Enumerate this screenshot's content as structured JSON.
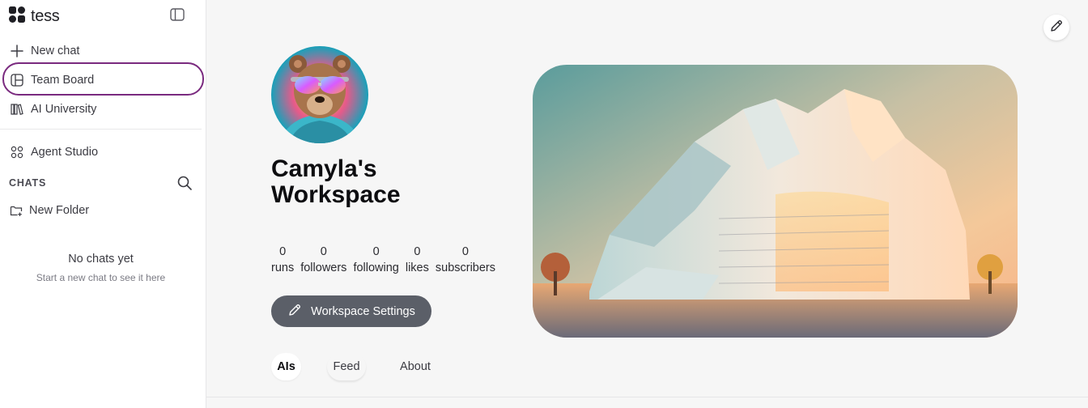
{
  "app": {
    "name": "tess"
  },
  "sidebar": {
    "new_chat": "New chat",
    "team_board": "Team Board",
    "ai_university": "AI University",
    "agent_studio": "Agent Studio",
    "chats_label": "CHATS",
    "new_folder": "New Folder",
    "empty_title": "No chats yet",
    "empty_subtitle": "Start a new chat to see it here"
  },
  "workspace": {
    "title_line1": "Camyla's",
    "title_line2": "Workspace",
    "stats": [
      {
        "value": "0",
        "label": "runs"
      },
      {
        "value": "0",
        "label": "followers"
      },
      {
        "value": "0",
        "label": "following"
      },
      {
        "value": "0",
        "label": "likes"
      },
      {
        "value": "0",
        "label": "subscribers"
      }
    ],
    "settings_button": "Workspace Settings"
  },
  "tabs": [
    {
      "label": "AIs",
      "active": true
    },
    {
      "label": "Feed",
      "active": false
    },
    {
      "label": "About",
      "active": false
    }
  ],
  "icons": {
    "logo": "tess-logo-icon",
    "collapse": "sidebar-collapse-icon",
    "new_chat": "plus-icon",
    "team_board": "board-icon",
    "ai_university": "books-icon",
    "agent_studio": "grid-icon",
    "search": "search-icon",
    "new_folder": "folder-plus-icon",
    "edit": "pencil-icon"
  },
  "colors": {
    "highlight_ring": "#7a2a7f",
    "settings_button_bg": "#5b5f68",
    "background": "#f6f6f6"
  }
}
